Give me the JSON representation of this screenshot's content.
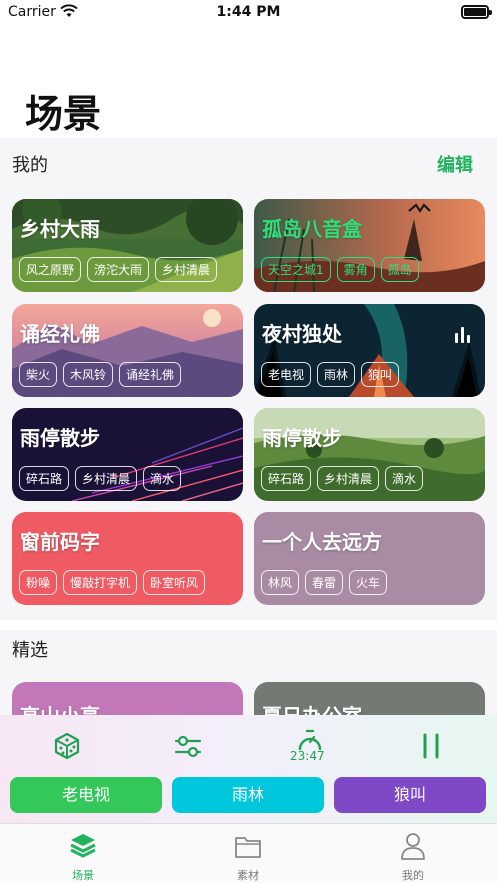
{
  "status_bar": {
    "carrier": "Carrier",
    "time": "1:44 PM"
  },
  "page": {
    "title": "场景"
  },
  "mine": {
    "header": "我的",
    "edit_label": "编辑",
    "cards": [
      {
        "title": "乡村大雨",
        "tags": [
          "风之原野",
          "滂沱大雨",
          "乡村清晨"
        ]
      },
      {
        "title": "孤岛八音盒",
        "tags": [
          "天空之城1",
          "雾角",
          "孤岛"
        ]
      },
      {
        "title": "诵经礼佛",
        "tags": [
          "柴火",
          "木风铃",
          "诵经礼佛"
        ]
      },
      {
        "title": "夜村独处",
        "tags": [
          "老电视",
          "雨林",
          "狼叫"
        ]
      },
      {
        "title": "雨停散步",
        "tags": [
          "碎石路",
          "乡村清晨",
          "滴水"
        ]
      },
      {
        "title": "雨停散步",
        "tags": [
          "碎石路",
          "乡村清晨",
          "滴水"
        ]
      },
      {
        "title": "窗前码字",
        "tags": [
          "粉噪",
          "慢敲打字机",
          "卧室听风"
        ]
      },
      {
        "title": "一个人去远方",
        "tags": [
          "林风",
          "春雷",
          "火车"
        ]
      }
    ]
  },
  "featured": {
    "header": "精选",
    "cards": [
      {
        "title": "高山小亭"
      },
      {
        "title": "夏日办公室"
      }
    ]
  },
  "player": {
    "timer": "23:47",
    "sounds": [
      "老电视",
      "雨林",
      "狼叫"
    ]
  },
  "tabs": [
    {
      "label": "场景",
      "active": true
    },
    {
      "label": "素材",
      "active": false
    },
    {
      "label": "我的",
      "active": false
    }
  ],
  "colors": {
    "accent": "#22b35e",
    "pill_green": "#34c759",
    "pill_cyan": "#00c7dc",
    "pill_purple": "#7e48c6",
    "card_red": "#f05a63",
    "card_mauve": "#a98ba4",
    "featured_pink": "#c277b8",
    "featured_gray": "#737a73"
  }
}
